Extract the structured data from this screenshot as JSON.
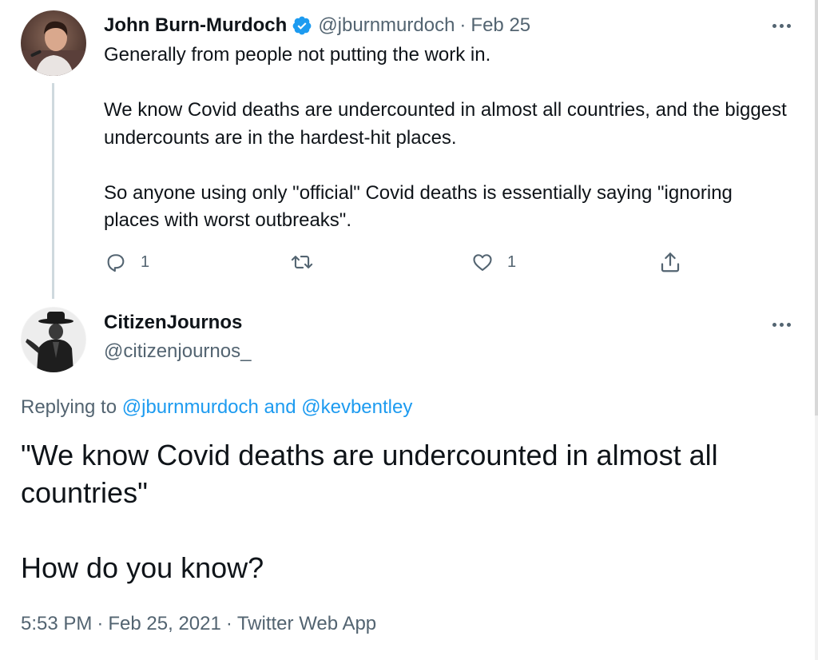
{
  "parent_tweet": {
    "author_name": "John Burn-Murdoch",
    "handle": "@jburnmurdoch",
    "date": "Feb 25",
    "paragraphs": [
      "Generally from people not putting the work in.",
      "We know Covid deaths are undercounted in almost all countries, and the biggest undercounts are in the hardest-hit places.",
      "So anyone using only \"official\" Covid deaths is essentially saying \"ignoring places with worst outbreaks\"."
    ],
    "actions": {
      "reply_count": "1",
      "like_count": "1"
    },
    "icons": {
      "verified": "verified-badge-icon",
      "reply": "reply-icon",
      "retweet": "retweet-icon",
      "like": "heart-icon",
      "share": "share-icon",
      "more": "more-icon"
    }
  },
  "focused_tweet": {
    "author_name": "CitizenJournos",
    "handle": "@citizenjournos_",
    "replying_label": "Replying to",
    "replying_to_1": "@jburnmurdoch",
    "replying_and": "and",
    "replying_to_2": "@kevbentley",
    "paragraphs": [
      "\"We know Covid deaths are undercounted in almost all countries\"",
      "How do you know?"
    ],
    "time": "5:53 PM",
    "full_date": "Feb 25, 2021",
    "source": "Twitter Web App"
  },
  "colors": {
    "text": "#0f1419",
    "secondary": "#536471",
    "link": "#1d9bf0",
    "thread_line": "#cfd9de"
  }
}
